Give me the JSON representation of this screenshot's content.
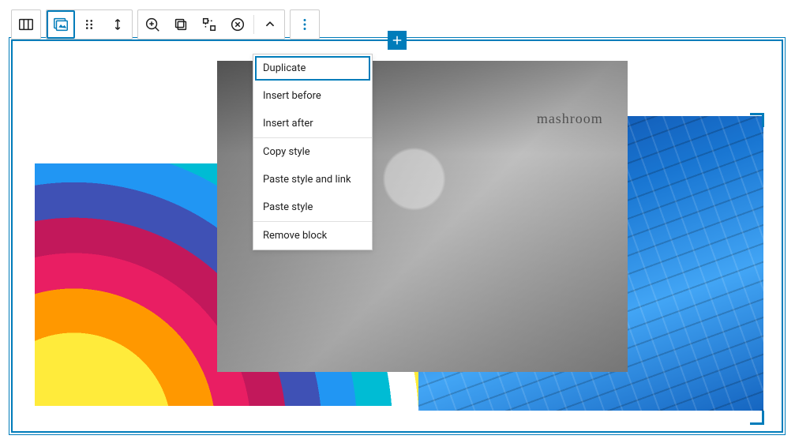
{
  "toolbar": {
    "columns_icon": "columns-icon",
    "image_icon": "image-icon",
    "drag_icon": "drag-icon",
    "arrows_icon": "arrows-v-icon",
    "zoom_icon": "zoom-in-icon",
    "copy_icon": "copy-icon",
    "replace_icon": "transform-icon",
    "remove_icon": "close-circle-icon",
    "up_icon": "chevron-up-icon",
    "more_icon": "more-vertical-icon"
  },
  "add_button_icon": "plus-icon",
  "context_menu": {
    "items": [
      {
        "label": "Duplicate"
      },
      {
        "label": "Insert before"
      },
      {
        "label": "Insert after"
      },
      {
        "label": "Copy style"
      },
      {
        "label": "Paste style and link"
      },
      {
        "label": "Paste style"
      },
      {
        "label": "Remove block"
      }
    ],
    "focused_index": 0,
    "dividers_after": [
      2,
      5
    ]
  },
  "images": {
    "balloon_alt": "rainbow-balloon-image",
    "meeting_alt": "team-highfive-image",
    "meeting_text": "mashroom",
    "building_alt": "blue-building-image"
  },
  "colors": {
    "accent": "#007cba"
  }
}
